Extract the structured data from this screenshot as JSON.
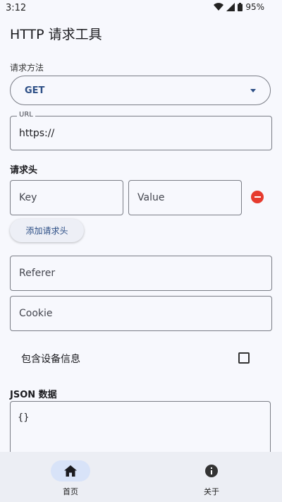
{
  "status": {
    "time": "3:12",
    "battery": "95%"
  },
  "app": {
    "title": "HTTP 请求工具"
  },
  "method": {
    "label": "请求方法",
    "value": "GET"
  },
  "url": {
    "label": "URL",
    "value": "https://"
  },
  "headers": {
    "section_title": "请求头",
    "key_placeholder": "Key",
    "value_placeholder": "Value",
    "add_label": "添加请求头"
  },
  "referer": {
    "placeholder": "Referer"
  },
  "cookie": {
    "placeholder": "Cookie"
  },
  "device_info": {
    "label": "包含设备信息",
    "checked": false
  },
  "json": {
    "section_title": "JSON 数据",
    "value": "{}"
  },
  "nav": {
    "items": [
      {
        "label": "首页",
        "icon": "home-icon",
        "active": true
      },
      {
        "label": "关于",
        "icon": "info-icon",
        "active": false
      }
    ]
  },
  "colors": {
    "accent": "#2d4f86",
    "danger": "#e63b2e",
    "nav_active": "#d8e3f8"
  }
}
